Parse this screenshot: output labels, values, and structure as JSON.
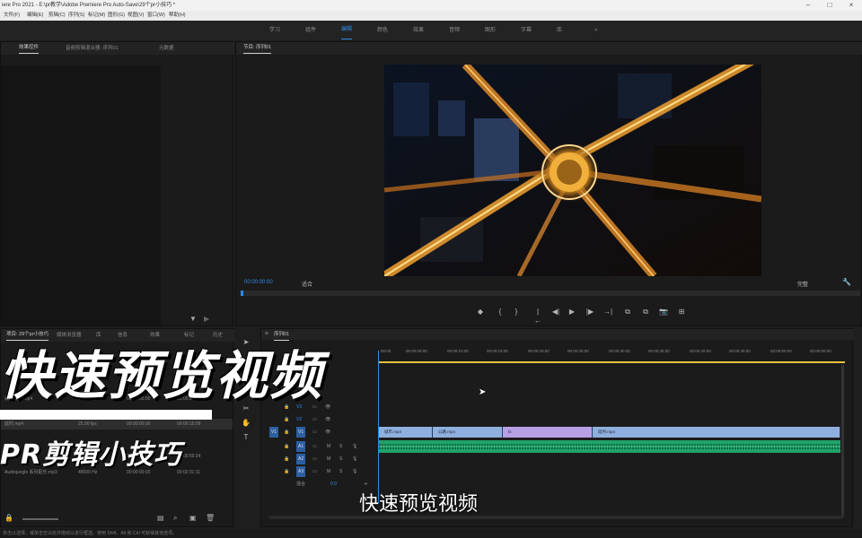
{
  "window": {
    "title": "iere Pro 2021 - E:\\pr教学\\Adobe Premiere Pro Auto-Save\\29个pr小技巧 *"
  },
  "menubar": {
    "items": [
      "文件(F)",
      "编辑(E)",
      "剪辑(C)",
      "序列(S)",
      "标记(M)",
      "图形(G)",
      "视图(V)",
      "窗口(W)",
      "帮助(H)"
    ]
  },
  "workspaces": {
    "items": [
      "学习",
      "组件",
      "编辑",
      "颜色",
      "效果",
      "音频",
      "图形",
      "字幕",
      "库"
    ],
    "active_index": 2,
    "more_label": "»"
  },
  "left_top_panel": {
    "tabs": [
      "效果控件",
      "音频剪辑混合器: 序列01",
      "元数据"
    ]
  },
  "program_monitor": {
    "tab_label": "节目: 序列01",
    "timecode": "00:00:00:00",
    "fit_label": "适合",
    "quality_label": "完整",
    "controls": [
      "◆",
      "{",
      "}",
      "|←",
      "◀|",
      "▶",
      "|▶",
      "→|",
      "⧉",
      "⧉",
      "📷",
      "⊞"
    ]
  },
  "project_panel": {
    "tabs": [
      "项目: 29个pr小技巧",
      "媒体浏览器",
      "库",
      "信息",
      "效果",
      "标记",
      "历史"
    ],
    "rows": [
      {
        "name": "城市夜景.mp4",
        "rate": "23.976 fps",
        "start": "00:00:00:00",
        "end": "00:00:28:14"
      },
      {
        "name": "延时.mp4",
        "rate": "25.00 fps",
        "start": "00:00:00:00",
        "end": "00:00:15:09"
      },
      {
        "name": "序列01",
        "rate": "25.00 fps",
        "start": "00:00:00:00",
        "end": "00:00:59:24"
      },
      {
        "name": "Audiojungle 系列配乐.mp3",
        "rate": "48000 Hz",
        "start": "00:00:00:00",
        "end": "00:02:31:11"
      }
    ]
  },
  "timeline": {
    "tab_label": "序列01",
    "ruler": [
      "00:00",
      "00:00:05:00",
      "00:00:10:00",
      "00:00:15:00",
      "00:00:20:00",
      "00:00:25:00",
      "00:00:30:00",
      "00:00:35:00",
      "00:00:40:00",
      "00:00:45:00",
      "00:00:50:00",
      "00:00:55:00"
    ],
    "tracks": [
      {
        "name": "V3"
      },
      {
        "name": "V2"
      },
      {
        "name": "V1",
        "source": "V1"
      },
      {
        "name": "A1",
        "source": "A1"
      },
      {
        "name": "A2"
      },
      {
        "name": "A3"
      }
    ],
    "master_label": "混合",
    "master_value": "0.0",
    "clips": [
      {
        "label": "城市.mp4",
        "color": "#8fb0de"
      },
      {
        "label": "公路.mp4",
        "color": "#8fb0de"
      },
      {
        "label": "fx",
        "color": "#b8a0e6"
      },
      {
        "label": "延时.mp4",
        "color": "#8fb0de"
      }
    ]
  },
  "overlay": {
    "title": "快速预览视频",
    "subtitle": "PR剪辑小技巧",
    "caption": "快速预览视频"
  },
  "statusbar": {
    "text": "单击以选择，或单击空白处并拖动以进行框选。使用 Shift、Alt 和 Ctrl 可获得其他选项。"
  },
  "colors": {
    "accent": "#2d8ceb",
    "audio_clip": "#1fa36a",
    "video_clip": "#8fb0de",
    "playhead_bar": "#e8c23a"
  }
}
